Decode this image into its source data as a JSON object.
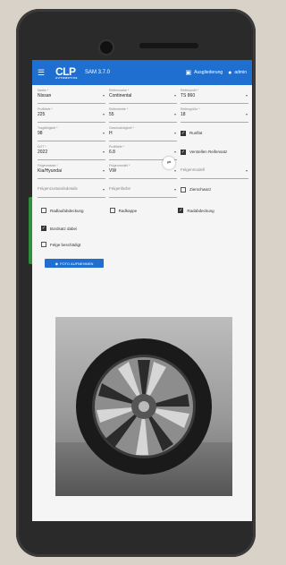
{
  "appbar": {
    "logo": "CLP",
    "logo_sub": "AUTOMOTIVE",
    "version": "SAM 3.7.0",
    "location": "Ausgliederung",
    "user": "admin"
  },
  "fields": [
    [
      {
        "label": "Marke *",
        "value": "Nissan"
      },
      {
        "label": "Reifenmarke *",
        "value": "Continental"
      },
      {
        "label": "Reifenprofil *",
        "value": "TS 860"
      }
    ],
    [
      {
        "label": "Profiltiefe *",
        "value": "225"
      },
      {
        "label": "Reifenbreite *",
        "value": "55"
      },
      {
        "label": "Reifengröße *",
        "value": "18"
      }
    ],
    [
      {
        "label": "Tragfähigkeit *",
        "value": "98"
      },
      {
        "label": "Geschwindigkeit *",
        "value": "H"
      },
      {
        "checkbox": true,
        "label": "Runflat",
        "checked": true
      }
    ],
    [
      {
        "label": "DOT *",
        "value": "2022"
      },
      {
        "label": "Profiltiefe *",
        "value": "6.8"
      },
      {
        "checkbox": true,
        "label": "Verstellen Reifensatz",
        "checked": true
      }
    ],
    [
      {
        "label": "Felgenmarke *",
        "value": "Kia/Hyundai"
      },
      {
        "label": "Felgenmodell *",
        "value": "VW"
      },
      {
        "label": "",
        "value": "Felgenmodell",
        "empty": true
      }
    ],
    [
      {
        "label": "",
        "value": "Felgenzustandsdetails",
        "empty": true
      },
      {
        "label": "",
        "value": "Felgenfarbe",
        "empty": true
      },
      {
        "checkbox": true,
        "label": "Zierschwarz",
        "checked": false
      }
    ]
  ],
  "checks_row": [
    {
      "label": "Radlaufabdeckung",
      "checked": false
    },
    {
      "label": "Radkappe",
      "checked": false
    },
    {
      "label": "Radabdeckung",
      "checked": true
    }
  ],
  "single_checks": [
    {
      "label": "Bordsatz dabei",
      "checked": true
    },
    {
      "label": "Felge beschädigt",
      "checked": false
    }
  ],
  "photo_button": "FOTO AUFNEHMEN",
  "icons": {
    "menu": "menu-icon",
    "location": "garage-icon",
    "user": "person-icon",
    "fab": "wheel-swap-icon"
  }
}
